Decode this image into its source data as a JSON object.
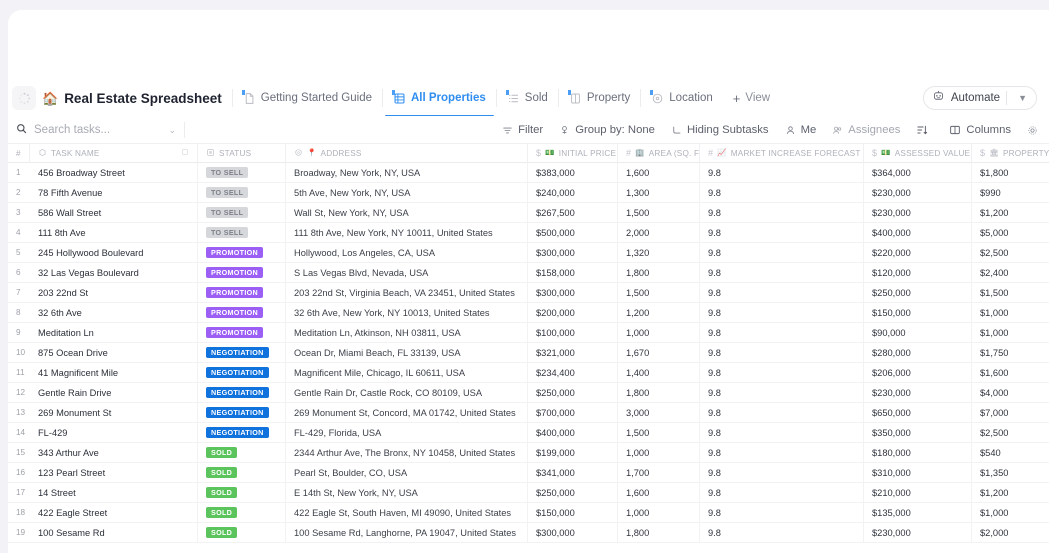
{
  "app": {
    "title": "Real Estate Spreadsheet",
    "logo_icon": "house-icon",
    "spinner_icon": "loading-spinner-icon"
  },
  "tabs": [
    {
      "label": "Getting Started Guide",
      "icon": "doc-icon",
      "active": false
    },
    {
      "label": "All Properties",
      "icon": "table-icon",
      "active": true
    },
    {
      "label": "Sold",
      "icon": "list-icon",
      "active": false
    },
    {
      "label": "Property",
      "icon": "board-icon",
      "active": false
    },
    {
      "label": "Location",
      "icon": "map-pin-icon",
      "active": false
    }
  ],
  "add_view": {
    "label": "View",
    "icon": "plus-icon"
  },
  "automate": {
    "label": "Automate",
    "icon": "robot-icon",
    "chevron": "chevron-down-icon"
  },
  "search": {
    "placeholder": "Search tasks...",
    "icon": "search-icon",
    "chevron": "chevron-down-icon"
  },
  "tools": [
    {
      "label": "Filter",
      "icon": "filter-icon",
      "muted": false
    },
    {
      "label": "Group by: None",
      "icon": "group-icon",
      "muted": false
    },
    {
      "label": "Hiding Subtasks",
      "icon": "subtask-icon",
      "muted": false
    },
    {
      "label": "Me",
      "icon": "person-icon",
      "muted": false
    },
    {
      "label": "Assignees",
      "icon": "people-icon",
      "muted": true
    },
    {
      "label": "",
      "icon": "sort-icon",
      "muted": false
    },
    {
      "label": "Columns",
      "icon": "columns-icon",
      "muted": false
    },
    {
      "label": "",
      "icon": "gear-icon",
      "muted": false
    }
  ],
  "columns": [
    {
      "key": "idx",
      "label": "#",
      "icon": "",
      "emoji": ""
    },
    {
      "key": "task",
      "label": "TASK NAME",
      "icon": "tag-icon",
      "emoji": ""
    },
    {
      "key": "status",
      "label": "STATUS",
      "icon": "status-icon",
      "emoji": ""
    },
    {
      "key": "addr",
      "label": "ADDRESS",
      "icon": "pin-icon",
      "emoji": "📍"
    },
    {
      "key": "price",
      "label": "INITIAL PRICE",
      "icon": "dollar-icon",
      "emoji": "💵"
    },
    {
      "key": "area",
      "label": "AREA (SQ. FT.)",
      "icon": "hash-icon",
      "emoji": "🏢"
    },
    {
      "key": "mkt",
      "label": "MARKET INCREASE FORECAST (%)",
      "icon": "hash-icon",
      "emoji": "📈"
    },
    {
      "key": "assess",
      "label": "ASSESSED VALUE",
      "icon": "dollar-icon",
      "emoji": "💵"
    },
    {
      "key": "tax",
      "label": "PROPERTY TAX (P",
      "icon": "dollar-icon",
      "emoji": "🏛"
    }
  ],
  "status_colors": {
    "TO SELL": "#d6d7db",
    "PROMOTION": "#9b5ff5",
    "NEGOTIATION": "#1072dd",
    "SOLD": "#5cc45c"
  },
  "rows": [
    {
      "idx": "1",
      "task": "456 Broadway Street",
      "status": "TO SELL",
      "addr": "Broadway, New York, NY, USA",
      "price": "$383,000",
      "area": "1,600",
      "mkt": "9.8",
      "assess": "$364,000",
      "tax": "$1,800"
    },
    {
      "idx": "2",
      "task": "78 Fifth Avenue",
      "status": "TO SELL",
      "addr": "5th Ave, New York, NY, USA",
      "price": "$240,000",
      "area": "1,300",
      "mkt": "9.8",
      "assess": "$230,000",
      "tax": "$990"
    },
    {
      "idx": "3",
      "task": "586 Wall Street",
      "status": "TO SELL",
      "addr": "Wall St, New York, NY, USA",
      "price": "$267,500",
      "area": "1,500",
      "mkt": "9.8",
      "assess": "$230,000",
      "tax": "$1,200"
    },
    {
      "idx": "4",
      "task": "111 8th Ave",
      "status": "TO SELL",
      "addr": "111 8th Ave, New York, NY 10011, United States",
      "price": "$500,000",
      "area": "2,000",
      "mkt": "9.8",
      "assess": "$400,000",
      "tax": "$5,000"
    },
    {
      "idx": "5",
      "task": "245 Hollywood Boulevard",
      "status": "PROMOTION",
      "addr": "Hollywood, Los Angeles, CA, USA",
      "price": "$300,000",
      "area": "1,320",
      "mkt": "9.8",
      "assess": "$220,000",
      "tax": "$2,500"
    },
    {
      "idx": "6",
      "task": "32 Las Vegas Boulevard",
      "status": "PROMOTION",
      "addr": "S Las Vegas Blvd, Nevada, USA",
      "price": "$158,000",
      "area": "1,800",
      "mkt": "9.8",
      "assess": "$120,000",
      "tax": "$2,400"
    },
    {
      "idx": "7",
      "task": "203 22nd St",
      "status": "PROMOTION",
      "addr": "203 22nd St, Virginia Beach, VA 23451, United States",
      "price": "$300,000",
      "area": "1,500",
      "mkt": "9.8",
      "assess": "$250,000",
      "tax": "$1,500"
    },
    {
      "idx": "8",
      "task": "32 6th Ave",
      "status": "PROMOTION",
      "addr": "32 6th Ave, New York, NY 10013, United States",
      "price": "$200,000",
      "area": "1,200",
      "mkt": "9.8",
      "assess": "$150,000",
      "tax": "$1,000"
    },
    {
      "idx": "9",
      "task": "Meditation Ln",
      "status": "PROMOTION",
      "addr": "Meditation Ln, Atkinson, NH 03811, USA",
      "price": "$100,000",
      "area": "1,000",
      "mkt": "9.8",
      "assess": "$90,000",
      "tax": "$1,000"
    },
    {
      "idx": "10",
      "task": "875 Ocean Drive",
      "status": "NEGOTIATION",
      "addr": "Ocean Dr, Miami Beach, FL 33139, USA",
      "price": "$321,000",
      "area": "1,670",
      "mkt": "9.8",
      "assess": "$280,000",
      "tax": "$1,750"
    },
    {
      "idx": "11",
      "task": "41 Magnificent Mile",
      "status": "NEGOTIATION",
      "addr": "Magnificent Mile, Chicago, IL 60611, USA",
      "price": "$234,400",
      "area": "1,400",
      "mkt": "9.8",
      "assess": "$206,000",
      "tax": "$1,600"
    },
    {
      "idx": "12",
      "task": "Gentle Rain Drive",
      "status": "NEGOTIATION",
      "addr": "Gentle Rain Dr, Castle Rock, CO 80109, USA",
      "price": "$250,000",
      "area": "1,800",
      "mkt": "9.8",
      "assess": "$230,000",
      "tax": "$4,000"
    },
    {
      "idx": "13",
      "task": "269 Monument St",
      "status": "NEGOTIATION",
      "addr": "269 Monument St, Concord, MA 01742, United States",
      "price": "$700,000",
      "area": "3,000",
      "mkt": "9.8",
      "assess": "$650,000",
      "tax": "$7,000"
    },
    {
      "idx": "14",
      "task": "FL-429",
      "status": "NEGOTIATION",
      "addr": "FL-429, Florida, USA",
      "price": "$400,000",
      "area": "1,500",
      "mkt": "9.8",
      "assess": "$350,000",
      "tax": "$2,500"
    },
    {
      "idx": "15",
      "task": "343 Arthur Ave",
      "status": "SOLD",
      "addr": "2344 Arthur Ave, The Bronx, NY 10458, United States",
      "price": "$199,000",
      "area": "1,000",
      "mkt": "9.8",
      "assess": "$180,000",
      "tax": "$540"
    },
    {
      "idx": "16",
      "task": "123 Pearl Street",
      "status": "SOLD",
      "addr": "Pearl St, Boulder, CO, USA",
      "price": "$341,000",
      "area": "1,700",
      "mkt": "9.8",
      "assess": "$310,000",
      "tax": "$1,350"
    },
    {
      "idx": "17",
      "task": "14 Street",
      "status": "SOLD",
      "addr": "E 14th St, New York, NY, USA",
      "price": "$250,000",
      "area": "1,600",
      "mkt": "9.8",
      "assess": "$210,000",
      "tax": "$1,200"
    },
    {
      "idx": "18",
      "task": "422 Eagle Street",
      "status": "SOLD",
      "addr": "422 Eagle St, South Haven, MI 49090, United States",
      "price": "$150,000",
      "area": "1,000",
      "mkt": "9.8",
      "assess": "$135,000",
      "tax": "$1,000"
    },
    {
      "idx": "19",
      "task": "100 Sesame Rd",
      "status": "SOLD",
      "addr": "100 Sesame Rd, Langhorne, PA 19047, United States",
      "price": "$300,000",
      "area": "1,800",
      "mkt": "9.8",
      "assess": "$230,000",
      "tax": "$2,000"
    }
  ]
}
